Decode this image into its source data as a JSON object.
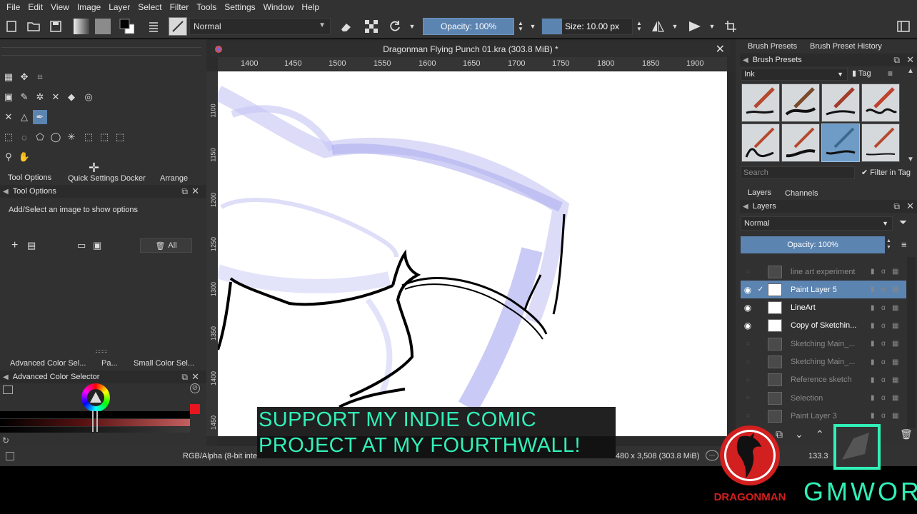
{
  "menu": [
    "File",
    "Edit",
    "View",
    "Image",
    "Layer",
    "Select",
    "Filter",
    "Tools",
    "Settings",
    "Window",
    "Help"
  ],
  "toolbar": {
    "blend_mode": "Normal",
    "opacity_label": "Opacity: 100%",
    "opacity_value": 1.0,
    "size_label": "Size: 10.00 px"
  },
  "document": {
    "tab_title": "Dragonman Flying Punch 01.kra (303.8 MiB) *"
  },
  "ruler": {
    "top_ticks": [
      "1400",
      "1450",
      "1500",
      "1550",
      "1600",
      "1650",
      "1700",
      "1750",
      "1800",
      "1850",
      "1900"
    ],
    "left_ticks": [
      "1100",
      "1150",
      "1200",
      "1250",
      "1300",
      "1350",
      "1400",
      "1450"
    ]
  },
  "left_tabs": [
    "Tool Options",
    "Quick Settings Docker",
    "Arrange"
  ],
  "tool_options": {
    "title": "Tool Options",
    "message": "Add/Select an image to show options",
    "all_button": "All"
  },
  "color_tabs": [
    "Advanced Color Sel...",
    "Pa...",
    "Small Color Sel..."
  ],
  "color_selector": {
    "title": "Advanced Color Selector",
    "fg_color": "#000000",
    "accent_red": "#e8141e"
  },
  "brush_panel": {
    "tabs": [
      "Brush Presets",
      "Brush Preset History"
    ],
    "title": "Brush Presets",
    "tag_combo": "Ink",
    "tag_label": "Tag",
    "search_placeholder": "Search",
    "filter_in_tag": "Filter in Tag",
    "selected_index": 6
  },
  "layers_panel": {
    "tabs": [
      "Layers",
      "Channels"
    ],
    "title": "Layers",
    "blend_mode": "Normal",
    "opacity_label": "Opacity:  100%",
    "layers": [
      {
        "name": "line art experiment",
        "visible": false,
        "active": false
      },
      {
        "name": "Paint Layer 5",
        "visible": true,
        "active": true
      },
      {
        "name": "LineArt",
        "visible": true,
        "active": false
      },
      {
        "name": "Copy of Sketchin...",
        "visible": true,
        "active": false
      },
      {
        "name": "Sketching Main_...",
        "visible": false,
        "active": false
      },
      {
        "name": "Sketching Main_...",
        "visible": false,
        "active": false
      },
      {
        "name": "Reference sketch",
        "visible": false,
        "active": false
      },
      {
        "name": "Selection",
        "visible": false,
        "active": false
      },
      {
        "name": "Paint Layer 3",
        "visible": false,
        "active": false
      }
    ]
  },
  "status": {
    "color_space": "RGB/Alpha (8-bit inte",
    "image_size": "480 x 3,508 (303.8 MiB)",
    "zoom": "133.3"
  },
  "caption": {
    "line1": "SUPPORT MY INDIE COMIC",
    "line2": "PROJECT AT MY FOURTHWALL!"
  },
  "logos": {
    "dragonman": "DRAGONMAN",
    "gmwor": "GMWOR"
  },
  "colors": {
    "accent_blue": "#5b84b1",
    "caption_green": "#31f0b7",
    "logo_red": "#d21f1f"
  }
}
